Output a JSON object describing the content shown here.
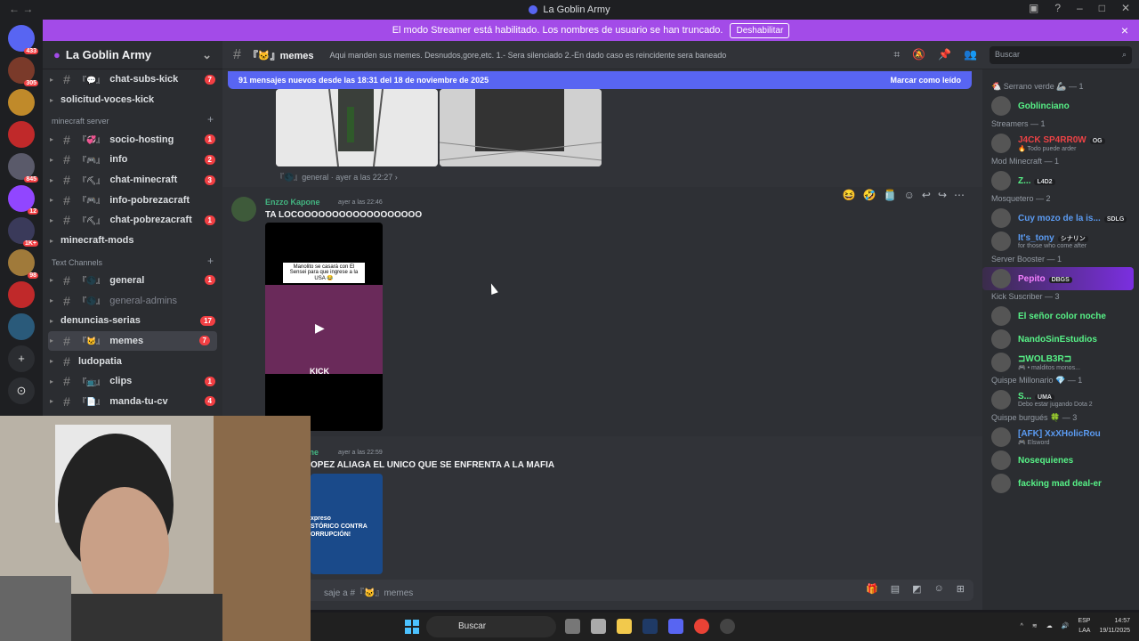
{
  "window": {
    "title": "La Goblin Army"
  },
  "servers": [
    {
      "badge": "433",
      "color": "#5865f2"
    },
    {
      "badge": "305",
      "color": "#7a3a2a"
    },
    {
      "badge": "",
      "color": "#c08a2a"
    },
    {
      "badge": "",
      "color": "#c0292a"
    },
    {
      "badge": "845",
      "color": "#5a5a6a"
    },
    {
      "badge": "12",
      "color": "#9146ff"
    },
    {
      "badge": "1K+",
      "color": "#3a3a5a"
    },
    {
      "badge": "98",
      "color": "#a07a3a"
    },
    {
      "badge": "",
      "color": "#c0292a"
    },
    {
      "badge": "",
      "color": "#2a5a7a"
    }
  ],
  "banner": {
    "text": "El modo Streamer está habilitado. Los nombres de usuario se han truncado.",
    "button": "Deshabilitar",
    "close": "×"
  },
  "guild": {
    "name": "La Goblin Army"
  },
  "channels": [
    {
      "type": "ch",
      "icon": "『💬』",
      "name": "chat-subs-kick",
      "count": "7",
      "muted": false
    },
    {
      "type": "ch",
      "icon": "",
      "name": "solicitud-voces-kick",
      "count": "",
      "muted": false,
      "nohash": true
    },
    {
      "type": "cat",
      "name": "minecraft server"
    },
    {
      "type": "ch",
      "icon": "『💞』",
      "name": "socio-hosting",
      "count": "1",
      "muted": false
    },
    {
      "type": "ch",
      "icon": "『🎮』",
      "name": "info",
      "count": "2",
      "muted": false
    },
    {
      "type": "ch",
      "icon": "『⛏』",
      "name": "chat-minecraft",
      "count": "3",
      "muted": false
    },
    {
      "type": "ch",
      "icon": "『🎮』",
      "name": "info-pobrezacraft",
      "count": "",
      "muted": false
    },
    {
      "type": "ch",
      "icon": "『⛏』",
      "name": "chat-pobrezacraft",
      "count": "1",
      "muted": false
    },
    {
      "type": "ch",
      "icon": "",
      "name": "minecraft-mods",
      "count": "",
      "muted": false,
      "nohash": true
    },
    {
      "type": "cat",
      "name": "Text Channels"
    },
    {
      "type": "ch",
      "icon": "『🌑』",
      "name": "general",
      "count": "1",
      "muted": false
    },
    {
      "type": "ch",
      "icon": "『🌑』",
      "name": "general-admins",
      "count": "",
      "muted": true
    },
    {
      "type": "ch",
      "icon": "",
      "name": "denuncias-serias",
      "count": "17",
      "muted": false,
      "nohash": true
    },
    {
      "type": "ch",
      "icon": "『🐱』",
      "name": "memes",
      "count": "7",
      "muted": false,
      "active": true
    },
    {
      "type": "ch",
      "icon": "",
      "name": "ludopatia",
      "count": "",
      "muted": false
    },
    {
      "type": "ch",
      "icon": "『📺』",
      "name": "clips",
      "count": "1",
      "muted": false
    },
    {
      "type": "ch",
      "icon": "『📄』",
      "name": "manda-tu-cv",
      "count": "4",
      "muted": false
    }
  ],
  "header": {
    "channel": "『🐱』memes",
    "topic": "Aqui manden sus memes. Desnudos,gore,etc. 1.- Sera silenciado 2.-En dado caso es reincidente sera baneado",
    "search_placeholder": "Buscar"
  },
  "newbar": {
    "text": "91 mensajes nuevos desde las 18:31 del 18 de noviembre de 2025",
    "mark": "Marcar como leído"
  },
  "messages": {
    "reply_ref": "『🌑』general · ayer a las 22:27 ›",
    "m1": {
      "author": "Enzzo Kapone",
      "time": "ayer a las 22:46",
      "text": "TA LOCOOOOOOOOOOOOOOOOOO",
      "video_caption": "Manolito se casará con El Sensei para que ingrese a la USA 😂",
      "video_mark": "KICK"
    },
    "m2": {
      "author_partial": "one",
      "time": "ayer a las 22:59",
      "text": "OPEZ ALIAGA EL UNICO QUE SE ENFRENTA A LA MAFIA",
      "thumb_text": "xpreso\nSTÓRICO CONTRA\nORRUPCIÓN!"
    }
  },
  "composer": {
    "placeholder": "saje a #『🐱』memes"
  },
  "members": [
    {
      "role": "🐔 Serrano verde 🦾 — 1"
    },
    {
      "name": "Goblinciano",
      "color": "#57f287",
      "sub": ""
    },
    {
      "role": "Streamers — 1"
    },
    {
      "name": "J4CK SP4RR0W",
      "color": "#ed4245",
      "tag": "OG",
      "sub": "🔥 Todo puede arder"
    },
    {
      "role": "Mod Minecraft — 1"
    },
    {
      "name": "Z...",
      "color": "#57f287",
      "tag": "L4D2",
      "sub": ""
    },
    {
      "role": "Mosquetero — 2"
    },
    {
      "name": "Cuy mozo de la is...",
      "color": "#5b9bf2",
      "tag": "SDLG",
      "sub": ""
    },
    {
      "name": "It's_tony",
      "color": "#5b9bf2",
      "tag": "シナリン",
      "sub": "for those who come after"
    },
    {
      "role": "Server Booster — 1"
    },
    {
      "name": "Pepito",
      "color": "#f47fff",
      "tag": "DBGS",
      "sub": "",
      "boost": true
    },
    {
      "role": "Kick Suscriber — 3"
    },
    {
      "name": "El señor color noche",
      "color": "#57f287",
      "sub": ""
    },
    {
      "name": "NandoSinEstudios",
      "color": "#57f287",
      "sub": ""
    },
    {
      "name": "⊐WOLB3R⊐",
      "color": "#57f287",
      "sub": "🎮 • malditos monos..."
    },
    {
      "role": "Quispe Millonario 💎 — 1"
    },
    {
      "name": "S...",
      "color": "#57f287",
      "tag": "UMA",
      "sub": "Debo estar jugando Dota 2"
    },
    {
      "role": "Quispe burgués 🍀 — 3"
    },
    {
      "name": "[AFK] XxXHolicRou",
      "color": "#5b9bf2",
      "sub": "🎮 Elsword"
    },
    {
      "name": "Nosequienes",
      "color": "#57f287",
      "sub": ""
    },
    {
      "name": "facking mad deal-er",
      "color": "#57f287",
      "sub": ""
    }
  ],
  "taskbar": {
    "search": "Buscar",
    "lang1": "ESP",
    "lang2": "LAA",
    "time": "14:57",
    "date": "19/11/2025"
  }
}
